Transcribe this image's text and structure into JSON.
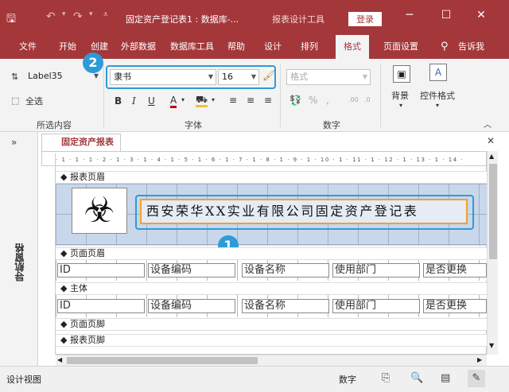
{
  "title_bar": {
    "title": "固定资产登记表1 : 数据库-...",
    "context_tools": "报表设计工具",
    "login": "登录"
  },
  "tabs": [
    {
      "label": "文件"
    },
    {
      "label": "开始"
    },
    {
      "label": "创建"
    },
    {
      "label": "外部数据"
    },
    {
      "label": "数据库工具"
    },
    {
      "label": "帮助"
    },
    {
      "label": "设计"
    },
    {
      "label": "排列"
    },
    {
      "label": "格式"
    },
    {
      "label": "页面设置"
    }
  ],
  "tell_me": "告诉我",
  "ribbon": {
    "object_combo": "Label35",
    "select_all": "全选",
    "font_name": "隶书",
    "font_size": "16",
    "number_format": "格式",
    "group_selection": "所选内容",
    "group_font": "字体",
    "group_number": "数字",
    "background_label": "背景",
    "control_format_label": "控件格式",
    "bold": "B",
    "italic": "I",
    "underline": "U",
    "font_color": "A",
    "percent": "%",
    "comma": ",",
    "decimal_inc": ".00",
    "decimal_dec": ".0"
  },
  "callouts": {
    "one": "1",
    "two": "2"
  },
  "nav_pane_label": "导航窗格",
  "document": {
    "tab_title": "固定资产报表",
    "sections": {
      "report_header": "报表页眉",
      "page_header": "页面页眉",
      "detail": "主体",
      "page_footer": "页面页脚",
      "report_footer": "报表页脚"
    },
    "title_label": "西安荣华XX实业有限公司固定资产登记表",
    "header_cells": [
      "ID",
      "设备编码",
      "设备名称",
      "使用部门",
      "是否更换"
    ],
    "detail_cells": [
      "ID",
      "设备编码",
      "设备名称",
      "使用部门",
      "是否更换"
    ],
    "ruler_text": "· 1 · 1 · 1 · 2 · 1 · 3 · 1 · 4 · 1 · 5 · 1 · 6 · 1 · 7 · 1 · 8 · 1 · 9 · 1 · 10 · 1 · 11 · 1 · 12 · 1 · 13 · 1 · 14 ·"
  },
  "status_bar": {
    "left": "设计视图",
    "mode": "数字"
  },
  "colors": {
    "accent": "#a4373a",
    "callout": "#2e9bd6",
    "selection": "#f0a030"
  }
}
